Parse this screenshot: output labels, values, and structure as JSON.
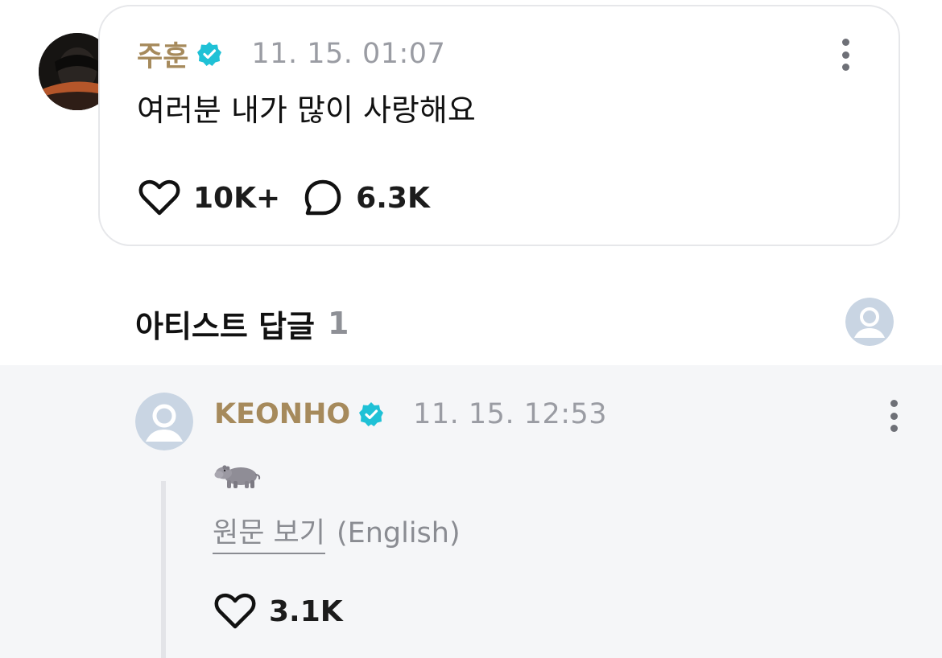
{
  "post": {
    "author": "주훈",
    "timestamp": "11. 15. 01:07",
    "text": "여러분 내가 많이 사랑해요",
    "likes": "10K+",
    "comments": "6.3K"
  },
  "artist_replies": {
    "title": "아티스트 답글",
    "count": "1"
  },
  "reply": {
    "author": "KEONHO",
    "timestamp": "11. 15. 12:53",
    "emoji_icon": "hippo-emoji-icon",
    "translate_link": "원문 보기",
    "translate_language": "(English)",
    "likes": "3.1K"
  },
  "colors": {
    "author_name": "#a68a5c",
    "verified_badge": "#1fc1d6",
    "reply_background": "#f5f6f8",
    "muted_text": "#9a9ca3"
  }
}
